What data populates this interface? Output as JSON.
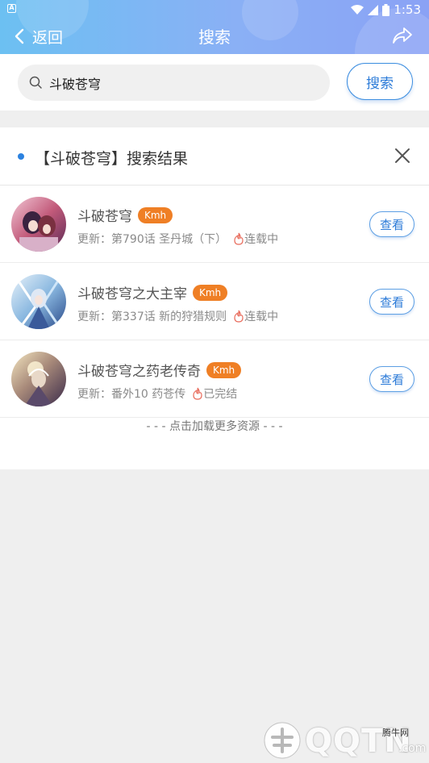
{
  "status_bar": {
    "app_icon": "A",
    "time": "1:53"
  },
  "navbar": {
    "back_label": "返回",
    "title": "搜索",
    "share_icon": "share-arrow-icon"
  },
  "search": {
    "value": "斗破苍穹",
    "button_label": "搜索"
  },
  "results": {
    "title": "【斗破苍穹】搜索结果",
    "items": [
      {
        "name": "斗破苍穹",
        "source": "Kmh",
        "update": "更新：第790话 圣丹城（下）",
        "status": "连载中",
        "button": "查看"
      },
      {
        "name": "斗破苍穹之大主宰",
        "source": "Kmh",
        "update": "更新：第337话 新的狩猎规则",
        "status": "连载中",
        "button": "查看"
      },
      {
        "name": "斗破苍穹之药老传奇",
        "source": "Kmh",
        "update": "更新：番外10 药苍传",
        "status": "已完结",
        "button": "查看"
      }
    ],
    "load_more": "- - - 点击加载更多资源 - - -"
  },
  "watermark": {
    "main": "QQTN",
    "sub": "腾牛网",
    "suffix": ".com"
  },
  "colors": {
    "accent": "#2c7bd8",
    "badge": "#ef7f25",
    "status_flame": "#e86a5a"
  }
}
